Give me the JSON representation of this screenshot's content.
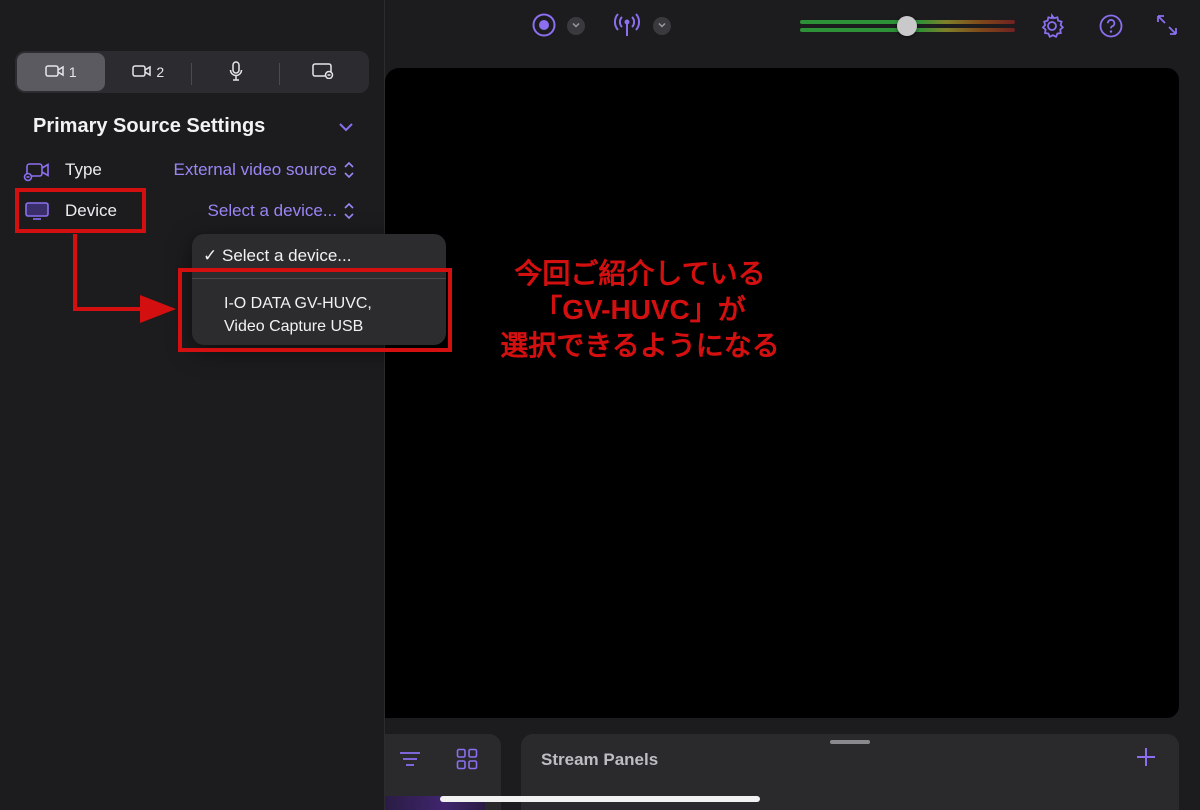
{
  "segments": [
    {
      "label": "1",
      "icon": "camera-icon"
    },
    {
      "label": "2",
      "icon": "camera-icon"
    },
    {
      "label": "",
      "icon": "microphone-icon"
    },
    {
      "label": "",
      "icon": "screen-share-icon"
    }
  ],
  "primary": {
    "title": "Primary Source Settings",
    "type_label": "Type",
    "type_value": "External video source",
    "device_label": "Device",
    "device_value": "Select a device..."
  },
  "dropdown": {
    "checked_option": "Select a device...",
    "option_line1": "I-O DATA GV-HUVC,",
    "option_line2": "Video Capture USB"
  },
  "annotation": {
    "line1": "今回ご紹介している",
    "line2": "「GV-HUVC」が",
    "line3": "選択できるようになる"
  },
  "bottom": {
    "stream_panels_title": "Stream Panels"
  },
  "colors": {
    "accent": "#8b6ff0",
    "value_text": "#9a86f5",
    "annotation_red": "#d40f0f"
  }
}
